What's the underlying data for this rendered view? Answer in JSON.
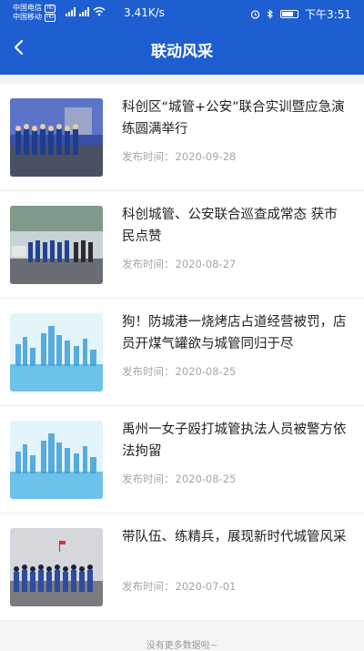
{
  "status": {
    "carrier1": "中国电信",
    "carrier2": "中国移动",
    "speed": "3.41K/s",
    "time": "下午3:51"
  },
  "header": {
    "title": "联动风采"
  },
  "items": [
    {
      "title": "科创区“城管+公安”联合实训暨应急演练圆满举行",
      "date_label": "发布时间：",
      "date": "2020-09-28",
      "thumb": "team-photo"
    },
    {
      "title": "科创城管、公安联合巡查成常态 获市民点赞",
      "date_label": "发布时间：",
      "date": "2020-08-27",
      "thumb": "team-photo"
    },
    {
      "title": "狗！防城港一烧烤店占道经营被罚，店员开煤气罐欲与城管同归于尽",
      "date_label": "发布时间：",
      "date": "2020-08-25",
      "thumb": "city-skyline"
    },
    {
      "title": "禹州一女子殴打城管执法人员被警方依法拘留",
      "date_label": "发布时间：",
      "date": "2020-08-25",
      "thumb": "city-skyline"
    },
    {
      "title": "带队伍、练精兵，展现新时代城管风采",
      "date_label": "发布时间：",
      "date": "2020-07-01",
      "thumb": "team-photo"
    }
  ],
  "footer": {
    "text": "没有更多数据啦~"
  }
}
